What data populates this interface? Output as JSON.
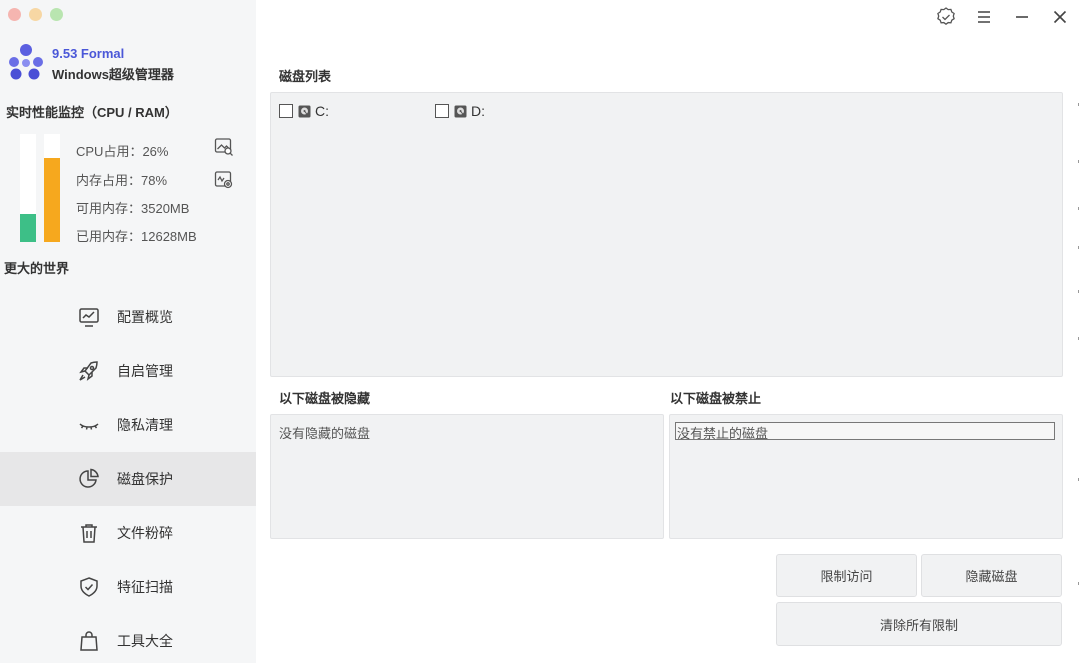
{
  "app": {
    "version": "9.53 Formal",
    "name": "Windows超级管理器"
  },
  "monitor": {
    "title": "实时性能监控（CPU / RAM）",
    "cpu_label": "CPU占用：26%",
    "mem_label": "内存占用：78%",
    "available_label": "可用内存：3520MB",
    "used_label": "已用内存：12628MB",
    "cpu_percent": 26,
    "mem_percent": 78,
    "cpu_color": "#3dbf87",
    "mem_color": "#f6a81e"
  },
  "sidebar": {
    "section_label": "更大的世界",
    "items": [
      {
        "label": "配置概览",
        "icon": "monitor-chart-icon"
      },
      {
        "label": "自启管理",
        "icon": "rocket-icon"
      },
      {
        "label": "隐私清理",
        "icon": "closed-eye-icon"
      },
      {
        "label": "磁盘保护",
        "icon": "pie-chart-icon",
        "active": true
      },
      {
        "label": "文件粉碎",
        "icon": "trash-icon"
      },
      {
        "label": "特征扫描",
        "icon": "shield-check-icon"
      },
      {
        "label": "工具大全",
        "icon": "bag-icon"
      }
    ]
  },
  "main": {
    "disk_list_title": "磁盘列表",
    "disks": [
      "C:",
      "D:"
    ],
    "hidden_title": "以下磁盘被隐藏",
    "hidden_empty": "没有隐藏的磁盘",
    "disabled_title": "以下磁盘被禁止",
    "disabled_empty": "没有禁止的磁盘",
    "buttons": {
      "restrict": "限制访问",
      "hide": "隐藏磁盘",
      "clear": "清除所有限制"
    }
  },
  "accent_color": "#4a57d8"
}
